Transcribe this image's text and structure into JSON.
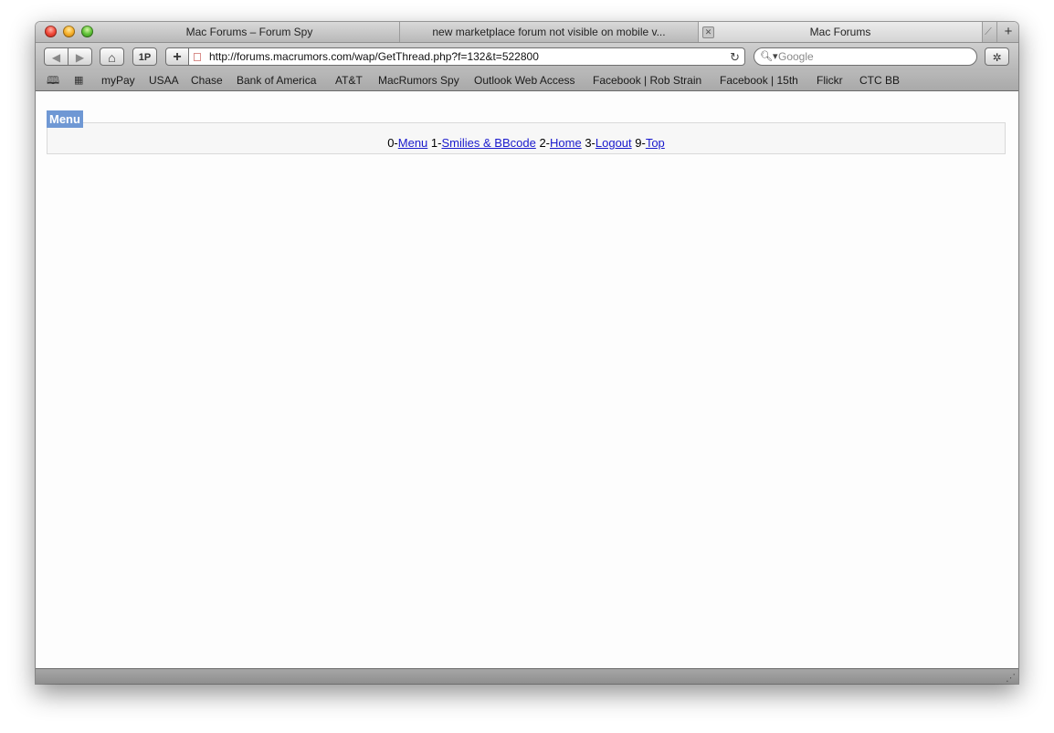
{
  "tabs": [
    {
      "title": "Mac Forums – Forum Spy"
    },
    {
      "title": "new marketplace forum not visible on mobile v..."
    },
    {
      "title": "Mac Forums"
    }
  ],
  "toolbar": {
    "back_label": "◀",
    "forward_label": "▶",
    "home_label": "⌂",
    "onepassword_label": "1P",
    "add_bookmark_label": "+",
    "url": "http://forums.macrumors.com/wap/GetThread.php?f=132&t=522800",
    "reload_label": "↻",
    "search_placeholder": "Google",
    "bug_label": "✲"
  },
  "bookmarks": {
    "items": [
      "myPay",
      "USAA",
      "Chase",
      "Bank of America",
      "AT&T",
      "MacRumors Spy",
      "Outlook Web Access",
      "Facebook | Rob Strain",
      "Facebook | 15th",
      "Flickr",
      "CTC BB"
    ]
  },
  "page": {
    "menu_heading": "Menu",
    "menu_items": [
      {
        "key": "0-",
        "label": "Menu"
      },
      {
        "key": " 1-",
        "label": "Smilies & BBcode"
      },
      {
        "key": " 2-",
        "label": "Home"
      },
      {
        "key": " 3-",
        "label": "Logout"
      },
      {
        "key": " 9-",
        "label": "Top"
      }
    ]
  }
}
